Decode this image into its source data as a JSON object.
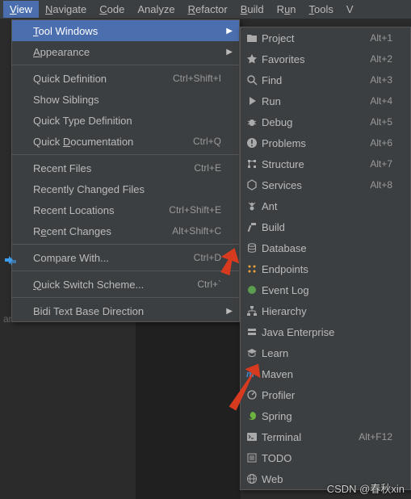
{
  "menubar": {
    "items": [
      {
        "label": "View",
        "mn": "V",
        "open": true
      },
      {
        "label": "Navigate",
        "mn": "N"
      },
      {
        "label": "Code",
        "mn": "C"
      },
      {
        "label": "Analyze",
        "mn": ""
      },
      {
        "label": "Refactor",
        "mn": "R"
      },
      {
        "label": "Build",
        "mn": "B"
      },
      {
        "label": "Run",
        "mn": "u"
      },
      {
        "label": "Tools",
        "mn": "T"
      },
      {
        "label": "V",
        "mn": ""
      }
    ]
  },
  "menu": [
    {
      "label": "Tool Windows",
      "mn": "T",
      "sub": true,
      "hl": true
    },
    {
      "label": "Appearance",
      "mn": "A",
      "sub": true
    },
    {
      "sep": true
    },
    {
      "label": "Quick Definition",
      "shortcut": "Ctrl+Shift+I"
    },
    {
      "label": "Show Siblings"
    },
    {
      "label": "Quick Type Definition"
    },
    {
      "label": "Quick Documentation",
      "mn": "D",
      "shortcut": "Ctrl+Q"
    },
    {
      "sep": true
    },
    {
      "label": "Recent Files",
      "shortcut": "Ctrl+E"
    },
    {
      "label": "Recently Changed Files"
    },
    {
      "label": "Recent Locations",
      "shortcut": "Ctrl+Shift+E"
    },
    {
      "label": "Recent Changes",
      "mn": "e",
      "shortcut": "Alt+Shift+C"
    },
    {
      "sep": true
    },
    {
      "label": "Compare With...",
      "shortcut": "Ctrl+D"
    },
    {
      "sep": true
    },
    {
      "label": "Quick Switch Scheme...",
      "mn": "Q",
      "shortcut": "Ctrl+`"
    },
    {
      "sep": true
    },
    {
      "label": "Bidi Text Base Direction",
      "sub": true
    }
  ],
  "submenu": [
    {
      "icon": "folder",
      "label": "Project",
      "shortcut": "Alt+1"
    },
    {
      "icon": "star",
      "label": "Favorites",
      "shortcut": "Alt+2"
    },
    {
      "icon": "search",
      "label": "Find",
      "shortcut": "Alt+3"
    },
    {
      "icon": "play",
      "label": "Run",
      "shortcut": "Alt+4"
    },
    {
      "icon": "bug",
      "label": "Debug",
      "shortcut": "Alt+5"
    },
    {
      "icon": "alert",
      "label": "Problems",
      "shortcut": "Alt+6"
    },
    {
      "icon": "structure",
      "label": "Structure",
      "shortcut": "Alt+7"
    },
    {
      "icon": "services",
      "label": "Services",
      "shortcut": "Alt+8"
    },
    {
      "icon": "ant",
      "label": "Ant"
    },
    {
      "icon": "hammer",
      "label": "Build"
    },
    {
      "icon": "db",
      "label": "Database"
    },
    {
      "icon": "endpoints",
      "label": "Endpoints"
    },
    {
      "icon": "event",
      "label": "Event Log"
    },
    {
      "icon": "hierarchy",
      "label": "Hierarchy"
    },
    {
      "icon": "jee",
      "label": "Java Enterprise"
    },
    {
      "icon": "learn",
      "label": "Learn"
    },
    {
      "icon": "maven",
      "label": "Maven"
    },
    {
      "icon": "profiler",
      "label": "Profiler"
    },
    {
      "icon": "spring",
      "label": "Spring"
    },
    {
      "icon": "terminal",
      "label": "Terminal",
      "shortcut": "Alt+F12"
    },
    {
      "icon": "todo",
      "label": "TODO"
    },
    {
      "icon": "web",
      "label": "Web"
    }
  ],
  "bgtext": "and Consoles",
  "watermark": "CSDN @春秋xin"
}
